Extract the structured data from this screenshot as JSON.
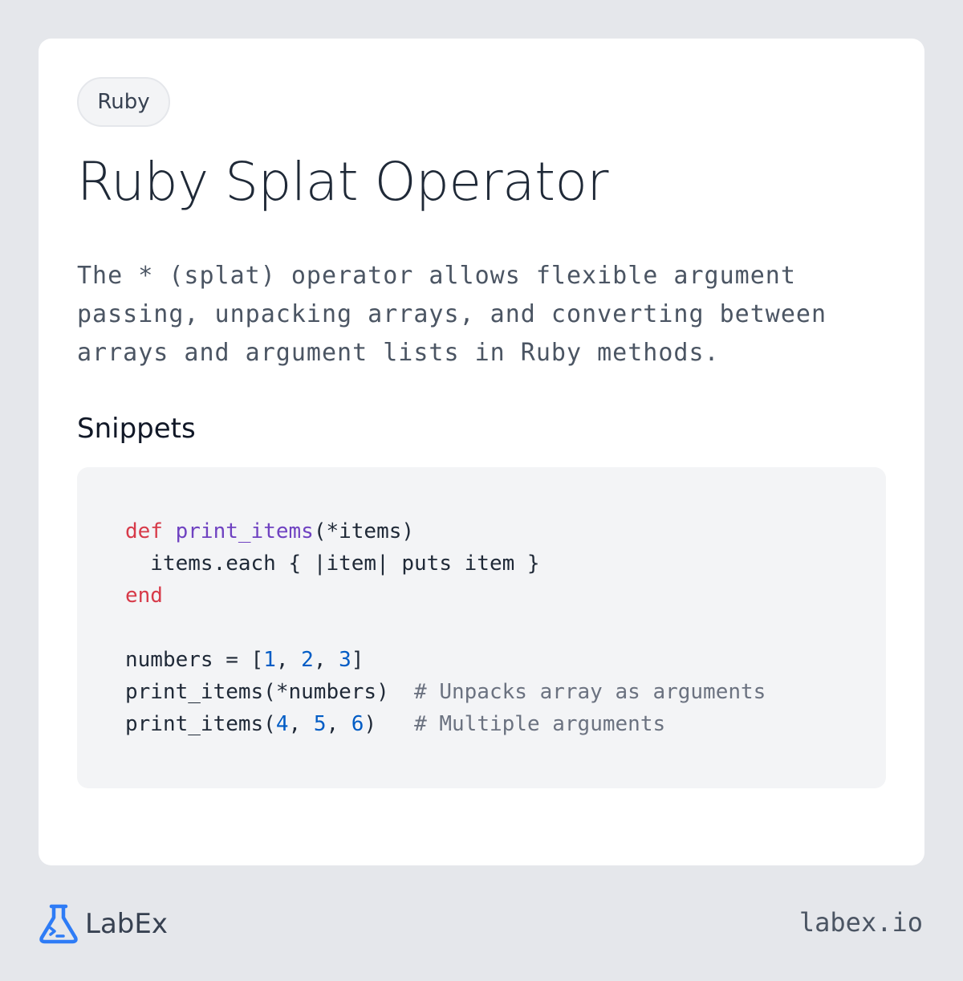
{
  "card": {
    "tag": "Ruby",
    "title": "Ruby Splat Operator",
    "description": "The * (splat) operator allows flexible argument passing, unpacking arrays, and converting between arrays and argument lists in Ruby methods.",
    "section_title": "Snippets"
  },
  "code": {
    "lines": [
      [
        {
          "t": "def",
          "c": "kw"
        },
        {
          "t": " "
        },
        {
          "t": "print_items",
          "c": "fn"
        },
        {
          "t": "(*items)"
        }
      ],
      [
        {
          "t": "  items.each { |item| puts item }"
        }
      ],
      [
        {
          "t": "end",
          "c": "kw"
        }
      ],
      [
        {
          "t": ""
        }
      ],
      [
        {
          "t": "numbers = ["
        },
        {
          "t": "1",
          "c": "num"
        },
        {
          "t": ", "
        },
        {
          "t": "2",
          "c": "num"
        },
        {
          "t": ", "
        },
        {
          "t": "3",
          "c": "num"
        },
        {
          "t": "]"
        }
      ],
      [
        {
          "t": "print_items(*numbers)  "
        },
        {
          "t": "# Unpacks array as arguments",
          "c": "cm"
        }
      ],
      [
        {
          "t": "print_items("
        },
        {
          "t": "4",
          "c": "num"
        },
        {
          "t": ", "
        },
        {
          "t": "5",
          "c": "num"
        },
        {
          "t": ", "
        },
        {
          "t": "6",
          "c": "num"
        },
        {
          "t": ")   "
        },
        {
          "t": "# Multiple arguments",
          "c": "cm"
        }
      ]
    ]
  },
  "footer": {
    "logo_text": "LabEx",
    "url": "labex.io",
    "brand_color": "#2e7cf6"
  }
}
